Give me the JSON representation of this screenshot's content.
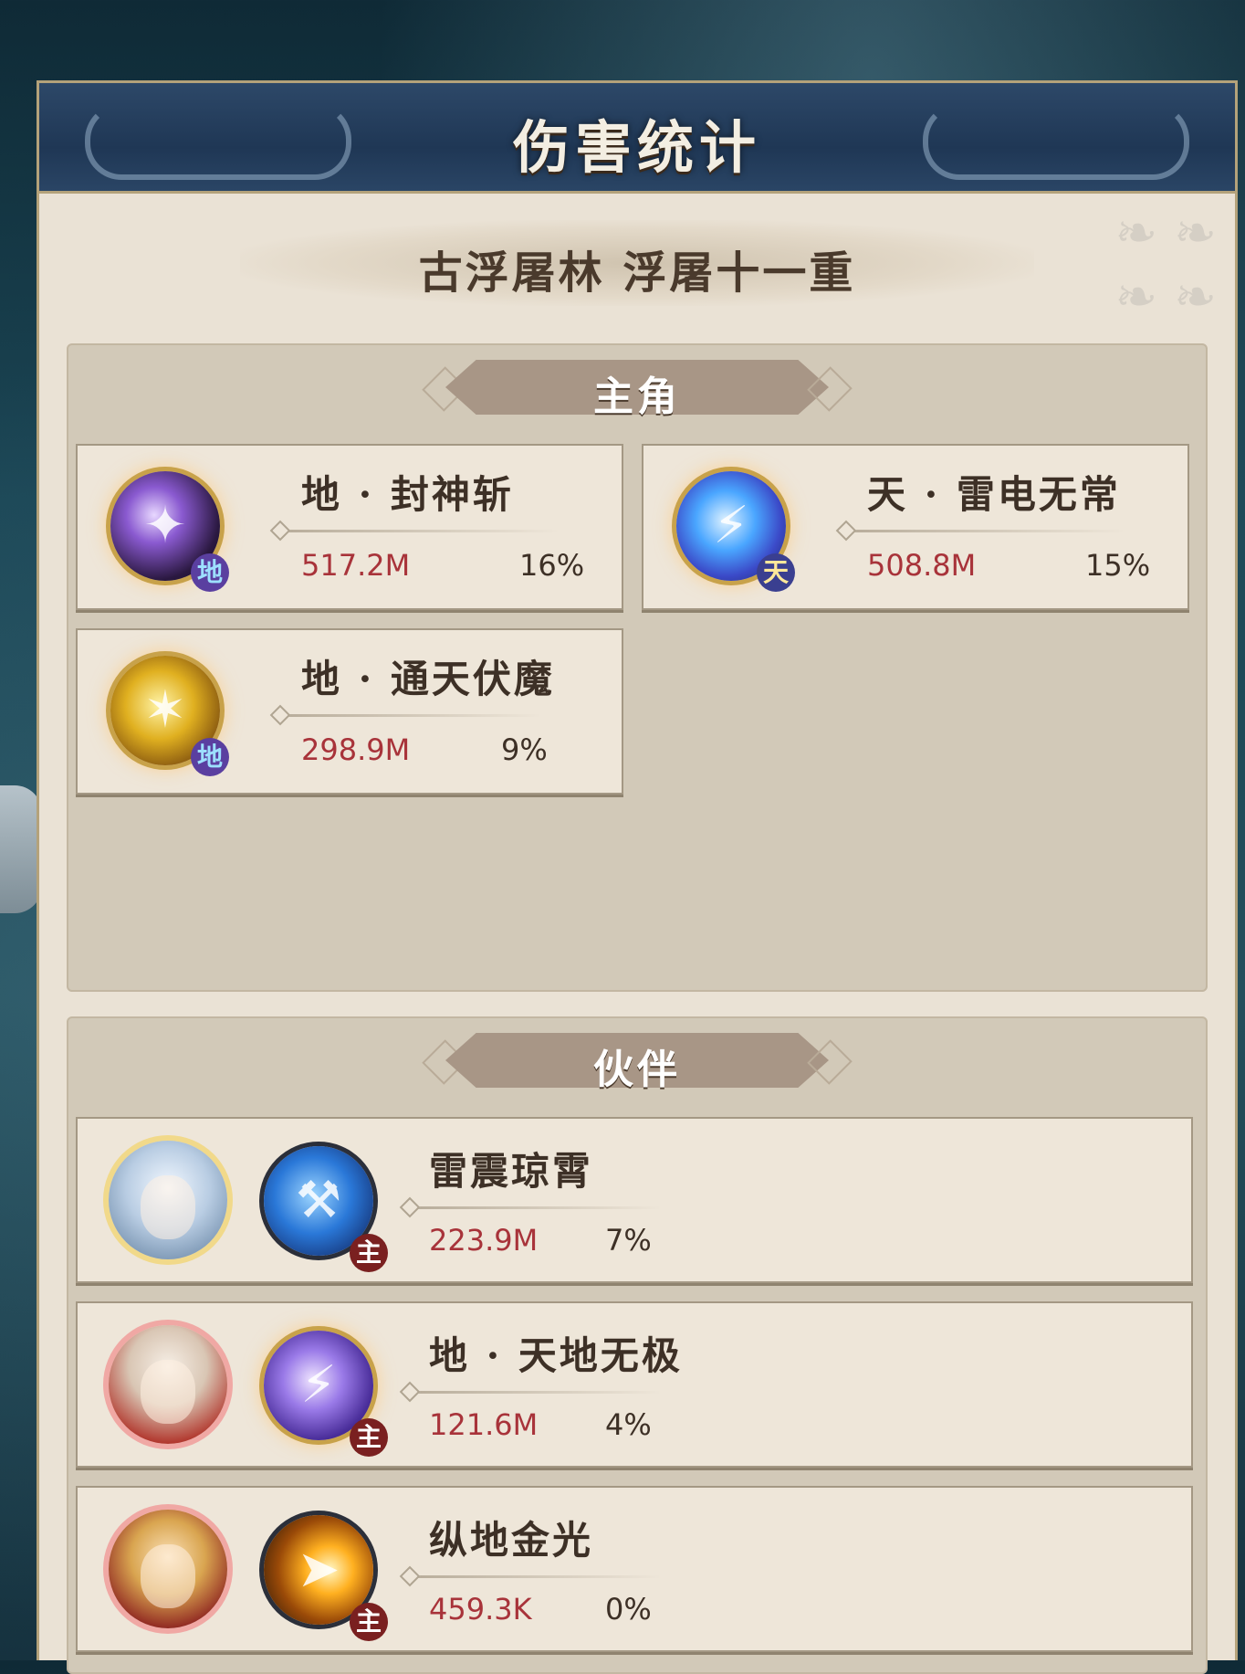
{
  "title": "伤害统计",
  "stage": "古浮屠林 浮屠十一重",
  "main_section": {
    "label": "主角",
    "skills": [
      {
        "name": "地 · 封神斩",
        "damage": "517.2M",
        "percent": "16%",
        "badge": "地"
      },
      {
        "name": "天 · 雷电无常",
        "damage": "508.8M",
        "percent": "15%",
        "badge": "天"
      },
      {
        "name": "地 · 通天伏魔",
        "damage": "298.9M",
        "percent": "9%",
        "badge": "地"
      }
    ]
  },
  "partner_section": {
    "label": "伙伴",
    "partners": [
      {
        "name": "雷震琼霄",
        "damage": "223.9M",
        "percent": "7%",
        "badge": "主"
      },
      {
        "name": "地 · 天地无极",
        "damage": "121.6M",
        "percent": "4%",
        "badge": "主"
      },
      {
        "name": "纵地金光",
        "damage": "459.3K",
        "percent": "0%",
        "badge": "主"
      }
    ]
  }
}
